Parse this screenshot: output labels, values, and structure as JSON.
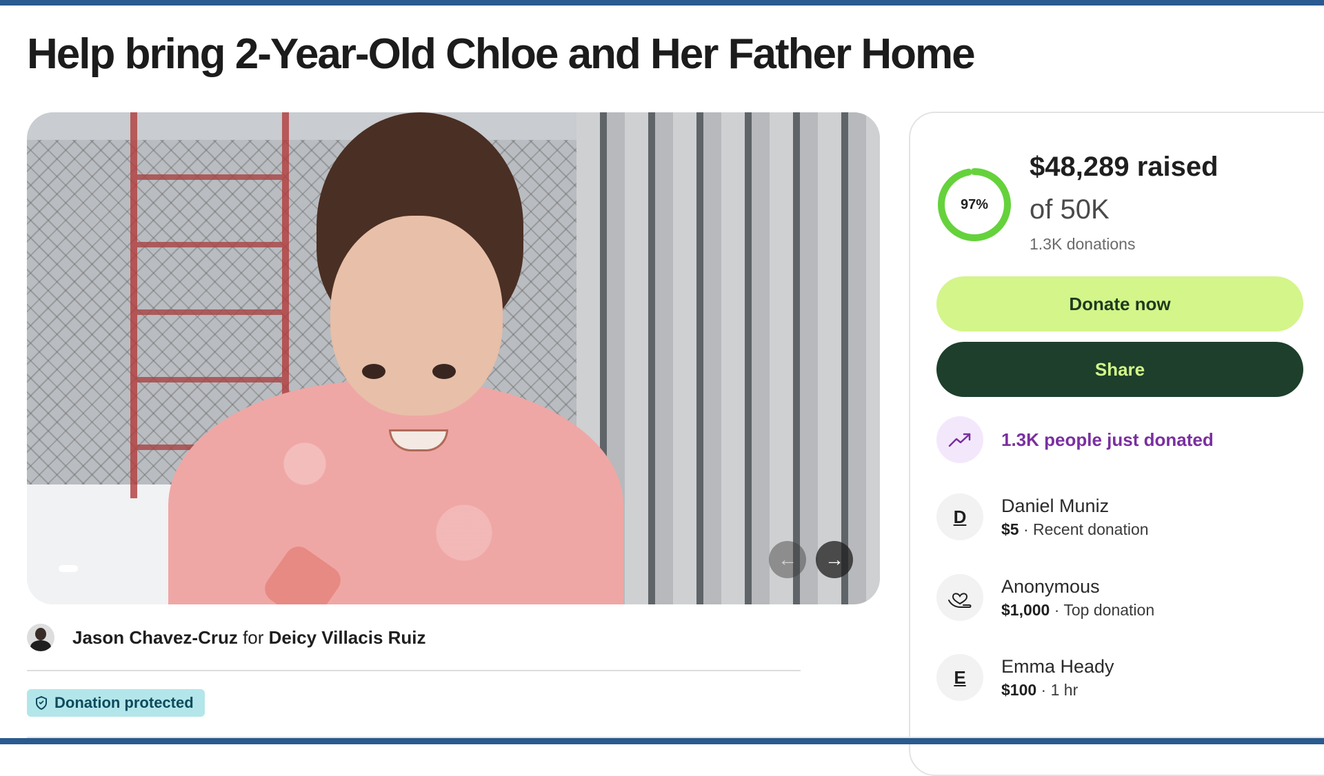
{
  "page": {
    "title": "Help bring 2-Year-Old Chloe and Her Father Home"
  },
  "gallery": {
    "prev_icon": "arrow-left-icon",
    "next_icon": "arrow-right-icon",
    "prev_glyph": "←",
    "next_glyph": "→"
  },
  "organizer": {
    "name": "Jason Chavez-Cruz",
    "connector": "for",
    "beneficiary": "Deicy Villacis Ruiz"
  },
  "badge": {
    "label": "Donation protected"
  },
  "donation": {
    "percent_label": "97%",
    "percent_value": 0.97,
    "raised": "$48,289 raised",
    "goal": "of 50K",
    "count": "1.3K donations",
    "donate_label": "Donate now",
    "share_label": "Share",
    "trend_label": "1.3K people just donated",
    "ring_color": "#65d23c",
    "ring_track_color": "#e6f7d6",
    "donate_color": "#d3f58a",
    "share_color": "#1d3f2b"
  },
  "donors": [
    {
      "initial": "D",
      "name": "Daniel Muniz",
      "amount": "$5",
      "note": " · Recent donation"
    },
    {
      "initial": "",
      "name": "Anonymous",
      "amount": "$1,000",
      "note": " · Top donation"
    },
    {
      "initial": "E",
      "name": "Emma Heady",
      "amount": "$100",
      "note": " · 1 hr"
    }
  ]
}
